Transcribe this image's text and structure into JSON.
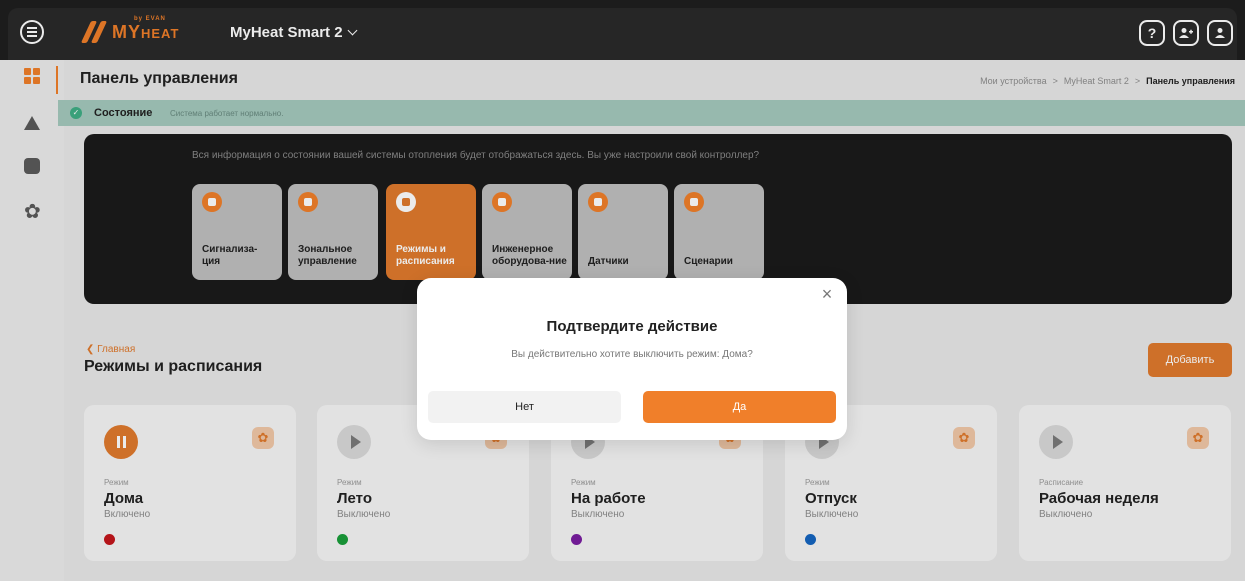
{
  "header": {
    "logo_text": "MY",
    "logo_sub": "by EVAN",
    "logo_word": "HEAT",
    "device_name": "MyHeat Smart 2",
    "icons": [
      "help-icon",
      "add-user-icon",
      "user-icon"
    ],
    "help_glyph": "?"
  },
  "sidebar": {
    "items": [
      "dashboard-icon",
      "warning-icon",
      "chart-icon",
      "gear-icon"
    ]
  },
  "page": {
    "title": "Панель управления",
    "breadcrumb": [
      "Мои устройства",
      "MyHeat Smart 2",
      "Панель управления"
    ],
    "breadcrumb_sep": ">"
  },
  "status": {
    "title": "Состояние",
    "text": "Система работает нормально."
  },
  "info_panel": {
    "text": "Вся информация о состоянии вашей системы отопления будет отображаться здесь. Вы уже настроили свой контроллер?",
    "tiles": [
      {
        "label": "Сигнализа-ция",
        "active": false
      },
      {
        "label": "Зональное управление",
        "active": false
      },
      {
        "label": "Режимы и расписания",
        "active": true
      },
      {
        "label": "Инженерное оборудова-ние",
        "active": false
      },
      {
        "label": "Датчики",
        "active": false
      },
      {
        "label": "Сценарии",
        "active": false
      }
    ]
  },
  "modes": {
    "back_label": "Главная",
    "title": "Режимы и расписания",
    "add_label": "Добавить",
    "cards": [
      {
        "type": "Режим",
        "name": "Дома",
        "state": "Включено",
        "color": "#c4161c",
        "on": true
      },
      {
        "type": "Режим",
        "name": "Лето",
        "state": "Выключено",
        "color": "#1a9e3a",
        "on": false
      },
      {
        "type": "Режим",
        "name": "На работе",
        "state": "Выключено",
        "color": "#7a1ea1",
        "on": false
      },
      {
        "type": "Режим",
        "name": "Отпуск",
        "state": "Выключено",
        "color": "#1565c0",
        "on": false
      },
      {
        "type": "Расписание",
        "name": "Рабочая неделя",
        "state": "Выключено",
        "color": "",
        "on": false
      }
    ]
  },
  "modal": {
    "title": "Подтвердите действие",
    "text": "Вы действительно хотите выключить режим: Дома?",
    "no_label": "Нет",
    "yes_label": "Да"
  },
  "colors": {
    "accent": "#f07f2a",
    "status_bg": "#a4c9bd",
    "dark_panel": "#1b1b1b"
  }
}
